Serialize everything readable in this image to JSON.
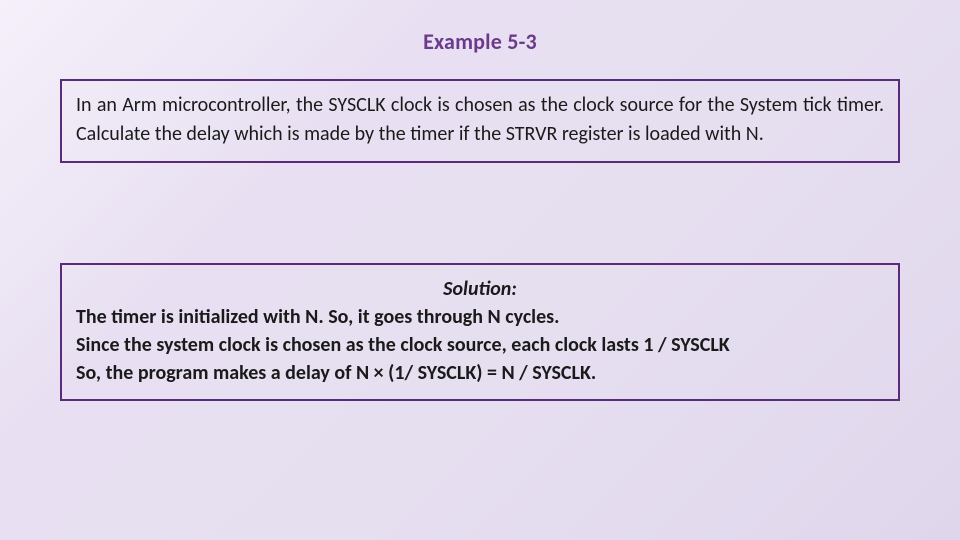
{
  "title": "Example 5-3",
  "problem": "In an Arm microcontroller, the SYSCLK clock is chosen as the clock source for the System tick timer. Calculate the delay which is made by the timer if the STRVR register is loaded with N.",
  "solution": {
    "header": "Solution:",
    "lines": [
      "The timer is initialized with N. So, it goes through N cycles.",
      "Since the system clock is chosen as the clock source, each clock lasts 1 / SYSCLK",
      "So, the program makes a delay of N × (1/ SYSCLK) = N / SYSCLK."
    ]
  }
}
